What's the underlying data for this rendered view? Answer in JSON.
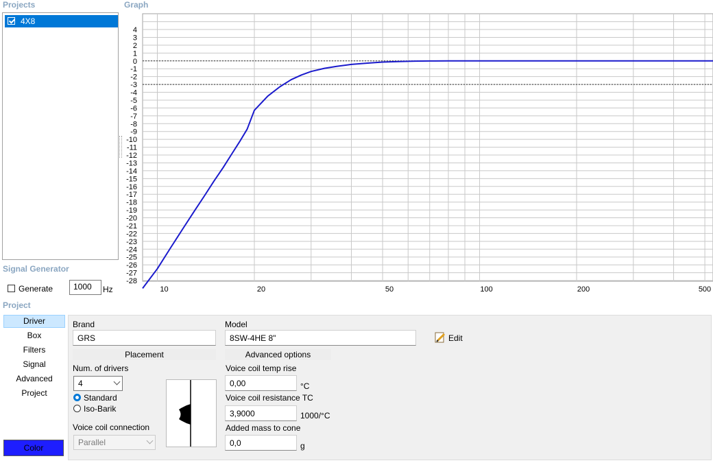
{
  "projects": {
    "title": "Projects",
    "items": [
      {
        "name": "4X8",
        "checked": true
      }
    ]
  },
  "graph": {
    "title": "Graph",
    "accent_color": "#1a1acc",
    "icon": "resize-grip-icon"
  },
  "chart_data": {
    "type": "line",
    "title": "",
    "xlabel": "",
    "ylabel": "",
    "x_scale": "log",
    "xlim": [
      9,
      530
    ],
    "ylim": [
      -29,
      5
    ],
    "x_ticks": [
      "10",
      "20",
      "50",
      "100",
      "200",
      "500"
    ],
    "x_tick_values": [
      10,
      20,
      50,
      100,
      200,
      500
    ],
    "y_ticks": [
      "4",
      "3",
      "2",
      "1",
      "0",
      "-1",
      "-2",
      "-3",
      "-4",
      "-5",
      "-6",
      "-7",
      "-8",
      "-9",
      "-10",
      "-11",
      "-12",
      "-13",
      "-14",
      "-15",
      "-16",
      "-17",
      "-18",
      "-19",
      "-20",
      "-21",
      "-22",
      "-23",
      "-24",
      "-25",
      "-26",
      "-27",
      "-28"
    ],
    "reference_lines": [
      {
        "y": 0,
        "style": "dotted"
      },
      {
        "y": -3,
        "style": "dotted"
      }
    ],
    "grid": true,
    "series": [
      {
        "color": "#1a1acc",
        "x": [
          9,
          10,
          11,
          12,
          13,
          14,
          15,
          16,
          17,
          18,
          19,
          20,
          22,
          24,
          26,
          28,
          30,
          33,
          36,
          40,
          45,
          50,
          56,
          63,
          70,
          80,
          100,
          150,
          200,
          300,
          530
        ],
        "y": [
          -29,
          -26.5,
          -23.8,
          -21.4,
          -19.2,
          -17.2,
          -15.3,
          -13.6,
          -11.9,
          -10.3,
          -8.7,
          -6.3,
          -4.5,
          -3.3,
          -2.4,
          -1.8,
          -1.35,
          -0.95,
          -0.7,
          -0.45,
          -0.28,
          -0.15,
          -0.08,
          -0.03,
          -0.01,
          0,
          0,
          0,
          0,
          0,
          0
        ]
      }
    ]
  },
  "signal_generator": {
    "title": "Signal Generator",
    "generate_label": "Generate",
    "frequency": "1000",
    "unit": "Hz"
  },
  "project": {
    "title": "Project",
    "tabs": [
      "Driver",
      "Box",
      "Filters",
      "Signal",
      "Advanced",
      "Project"
    ],
    "active_tab": "Driver",
    "color_button": "Color",
    "color_value": "#1e1eff"
  },
  "driver": {
    "brand_label": "Brand",
    "brand": "GRS",
    "model_label": "Model",
    "model": "8SW-4HE 8\"",
    "edit_label": "Edit",
    "placement_header": "Placement",
    "num_drivers_label": "Num. of drivers",
    "num_drivers": "4",
    "standard_label": "Standard",
    "isobarik_label": "Iso-Barik",
    "selected_placement": "Standard",
    "vc_connection_label": "Voice coil connection",
    "vc_connection": "Parallel",
    "advanced_header": "Advanced options",
    "vc_temp_label": "Voice coil temp rise",
    "vc_temp": "0,00",
    "vc_temp_unit": "°C",
    "vc_res_label": "Voice coil resistance TC",
    "vc_res": "3,9000",
    "vc_res_unit": "1000/°C",
    "added_mass_label": "Added mass to cone",
    "added_mass": "0,0",
    "added_mass_unit": "g"
  }
}
